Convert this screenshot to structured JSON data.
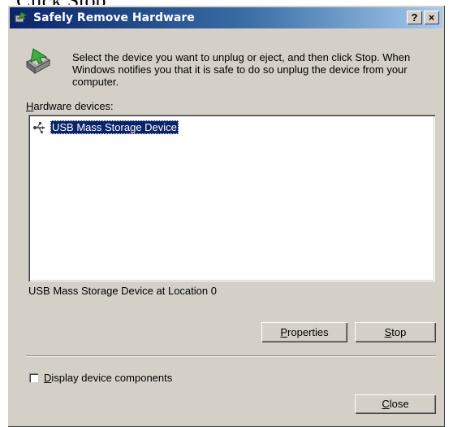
{
  "caption": "Click Stop",
  "window": {
    "title": "Safely Remove Hardware",
    "help_button": "?",
    "close_button": "×"
  },
  "instructions": "Select the device you want to unplug or eject, and then click Stop. When Windows notifies you that it is safe to do so unplug the device from your computer.",
  "hardware_label": {
    "mnemonic": "H",
    "rest": "ardware devices:"
  },
  "devices": [
    {
      "label": "USB Mass Storage Device",
      "icon": "usb-device-icon",
      "selected": true
    }
  ],
  "status_text": "USB Mass Storage Device at Location 0",
  "buttons": {
    "properties": {
      "mnemonic": "P",
      "rest": "roperties"
    },
    "stop": {
      "mnemonic": "S",
      "rest": "top"
    },
    "close": {
      "mnemonic": "C",
      "rest": "lose"
    }
  },
  "checkbox": {
    "mnemonic": "D",
    "rest": "isplay device components",
    "checked": false
  },
  "colors": {
    "title_gradient_start": "#0a246a",
    "title_gradient_end": "#a6caf0",
    "window_face": "#d4d0c8",
    "selection": "#0a246a"
  }
}
